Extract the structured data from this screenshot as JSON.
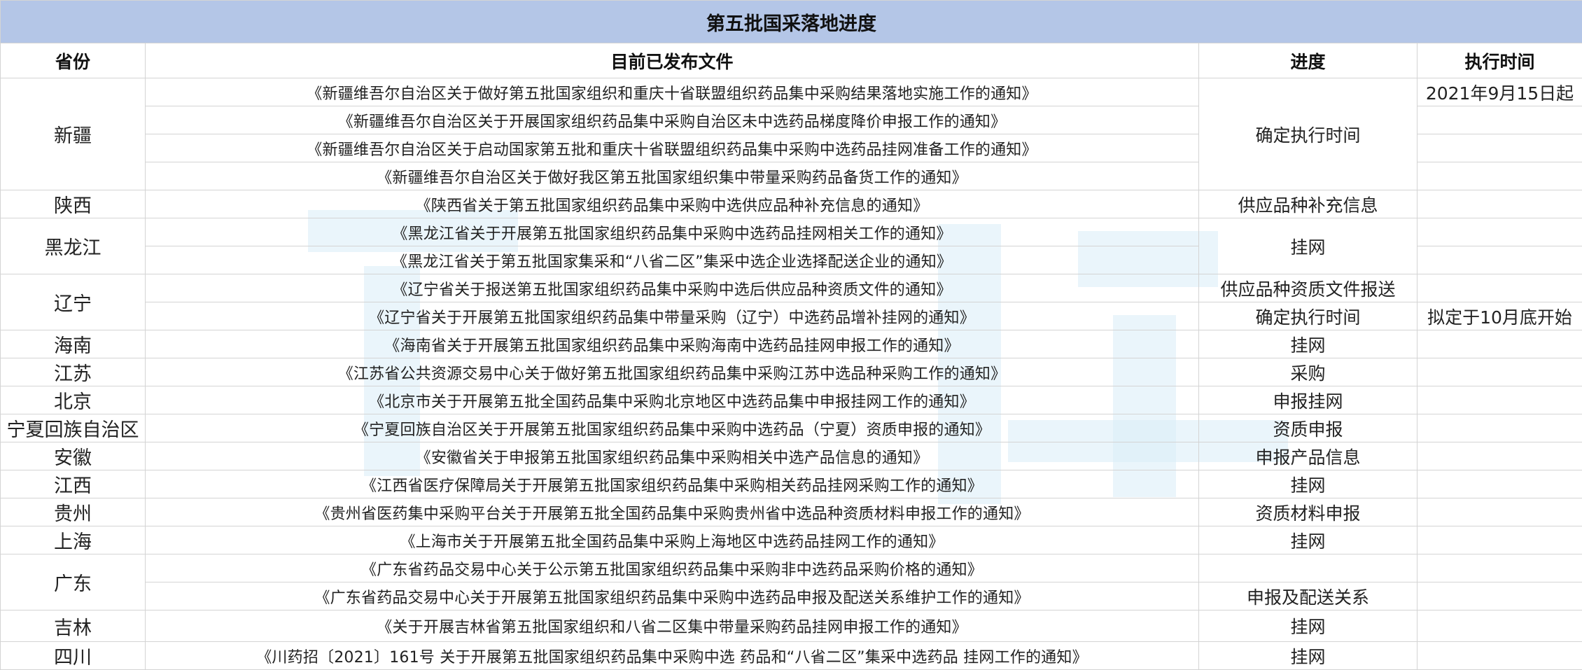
{
  "title": "第五批国采落地进度",
  "headers": {
    "province": "省份",
    "document": "目前已发布文件",
    "progress": "进度",
    "exec_time": "执行时间"
  },
  "provinces": {
    "xinjiang": "新疆",
    "shaanxi": "陕西",
    "heilongjiang": "黑龙江",
    "liaoning": "辽宁",
    "hainan": "海南",
    "jiangsu": "江苏",
    "beijing": "北京",
    "ningxia": "宁夏回族自治区",
    "anhui": "安徽",
    "jiangxi": "江西",
    "guizhou": "贵州",
    "shanghai": "上海",
    "guangdong": "广东",
    "jilin": "吉林",
    "sichuan": "四川"
  },
  "docs": [
    "《新疆维吾尔自治区关于做好第五批国家组织和重庆十省联盟组织药品集中采购结果落地实施工作的通知》",
    "《新疆维吾尔自治区关于开展国家组织药品集中采购自治区未中选药品梯度降价申报工作的通知》",
    "《新疆维吾尔自治区关于启动国家第五批和重庆十省联盟组织药品集中采购中选药品挂网准备工作的通知》",
    "《新疆维吾尔自治区关于做好我区第五批国家组织集中带量采购药品备货工作的通知》",
    "《陕西省关于第五批国家组织药品集中采购中选供应品种补充信息的通知》",
    "《黑龙江省关于开展第五批国家组织药品集中采购中选药品挂网相关工作的通知》",
    "《黑龙江省关于第五批国家集采和“八省二区”集采中选企业选择配送企业的通知》",
    "《辽宁省关于报送第五批国家组织药品集中采购中选后供应品种资质文件的通知》",
    "《辽宁省关于开展第五批国家组织药品集中带量采购（辽宁）中选药品增补挂网的通知》",
    "《海南省关于开展第五批国家组织药品集中采购海南中选药品挂网申报工作的通知》",
    "《江苏省公共资源交易中心关于做好第五批国家组织药品集中采购江苏中选品种采购工作的通知》",
    "《北京市关于开展第五批全国药品集中采购北京地区中选药品集中申报挂网工作的通知》",
    "《宁夏回族自治区关于开展第五批国家组织药品集中采购中选药品（宁夏）资质申报的通知》",
    "《安徽省关于申报第五批国家组织药品集中采购相关中选产品信息的通知》",
    "《江西省医疗保障局关于开展第五批国家组织药品集中采购相关药品挂网采购工作的通知》",
    "《贵州省医药集中采购平台关于开展第五批全国药品集中采购贵州省中选品种资质材料申报工作的通知》",
    "《上海市关于开展第五批全国药品集中采购上海地区中选药品挂网工作的通知》",
    "《广东省药品交易中心关于公示第五批国家组织药品集中采购非中选药品采购价格的通知》",
    "《广东省药品交易中心关于开展第五批国家组织药品集中采购中选药品申报及配送关系维护工作的通知》",
    "《关于开展吉林省第五批国家组织和八省二区集中带量采购药品挂网申报工作的通知》",
    "《川药招〔2021〕161号 关于开展第五批国家组织药品集中采购中选 药品和“八省二区”集采中选药品 挂网工作的通知》"
  ],
  "progress": {
    "xinjiang": "确定执行时间",
    "shaanxi": "供应品种补充信息",
    "heilongjiang": "挂网",
    "liaoning_1": "供应品种资质文件报送",
    "liaoning_2": "确定执行时间",
    "hainan": "挂网",
    "jiangsu": "采购",
    "beijing": "申报挂网",
    "ningxia": "资质申报",
    "anhui": "申报产品信息",
    "jiangxi": "挂网",
    "guizhou": "资质材料申报",
    "shanghai": "挂网",
    "guangdong_2": "申报及配送关系",
    "jilin": "挂网",
    "sichuan": "挂网"
  },
  "exec_time": {
    "xinjiang": "2021年9月15日起",
    "liaoning": "拟定于10月底开始"
  }
}
